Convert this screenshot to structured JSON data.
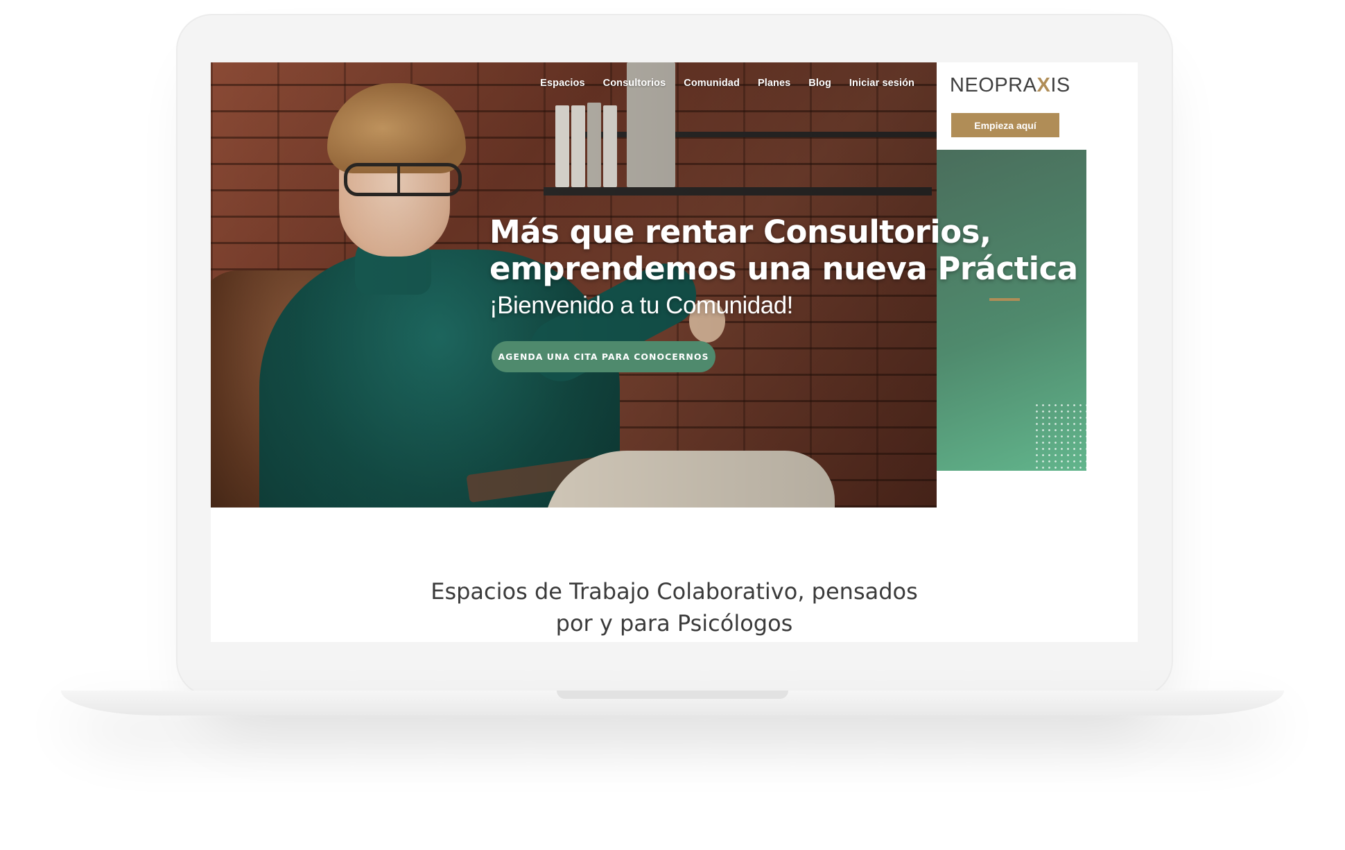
{
  "nav": {
    "items": [
      {
        "label": "Espacios"
      },
      {
        "label": "Consultorios"
      },
      {
        "label": "Comunidad"
      },
      {
        "label": "Planes"
      },
      {
        "label": "Blog"
      },
      {
        "label": "Iniciar sesión"
      }
    ]
  },
  "brand": {
    "logo_part1": "NEO",
    "logo_part2": "PRA",
    "logo_x": "X",
    "logo_part3": "IS",
    "accent_color": "#b08d57",
    "green_color": "#4f8a6d"
  },
  "header": {
    "cta_label": "Empieza aquí"
  },
  "hero": {
    "headline_line1": "Más que rentar Consultorios,",
    "headline_line2": "emprendemos una nueva Práctica",
    "subheadline": "¡Bienvenido a tu Comunidad!",
    "cta_label": "AGENDA UNA CITA PARA CONOCERNOS",
    "image": "woman-psychologist-photo"
  },
  "section": {
    "title_line1": "Espacios de Trabajo Colaborativo, pensados",
    "title_line2": "por y para Psicólogos"
  }
}
